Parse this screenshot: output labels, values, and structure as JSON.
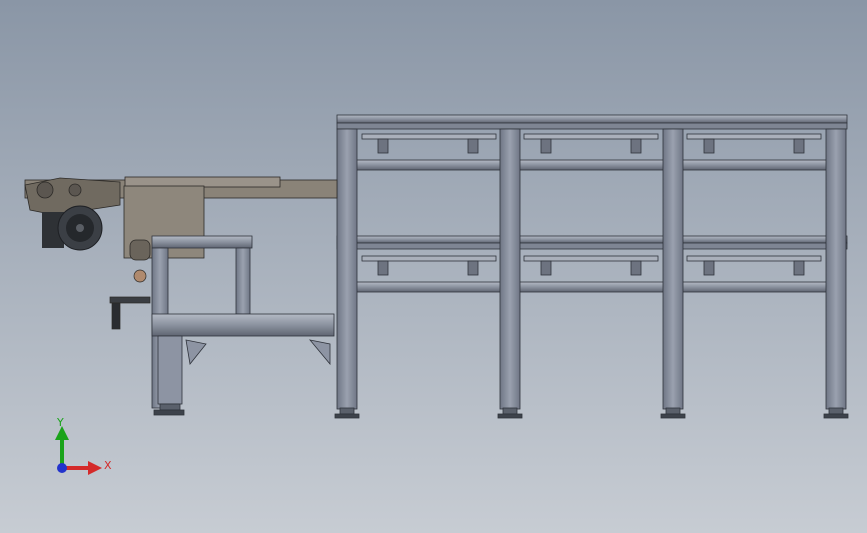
{
  "viewport": {
    "background_top": "#8a96a6",
    "background_bottom": "#c7ccd3"
  },
  "model": {
    "frame_color": "#8d94a3",
    "frame_dark": "#4a4f5a",
    "arm_color": "#7a746a",
    "motor_color": "#3a3d42",
    "accent_color": "#b08a6e"
  },
  "triad": {
    "y_label": "Y",
    "x_label": "X",
    "y_color": "#1aa31a",
    "x_color": "#d42a2a",
    "z_color": "#2233cc"
  }
}
